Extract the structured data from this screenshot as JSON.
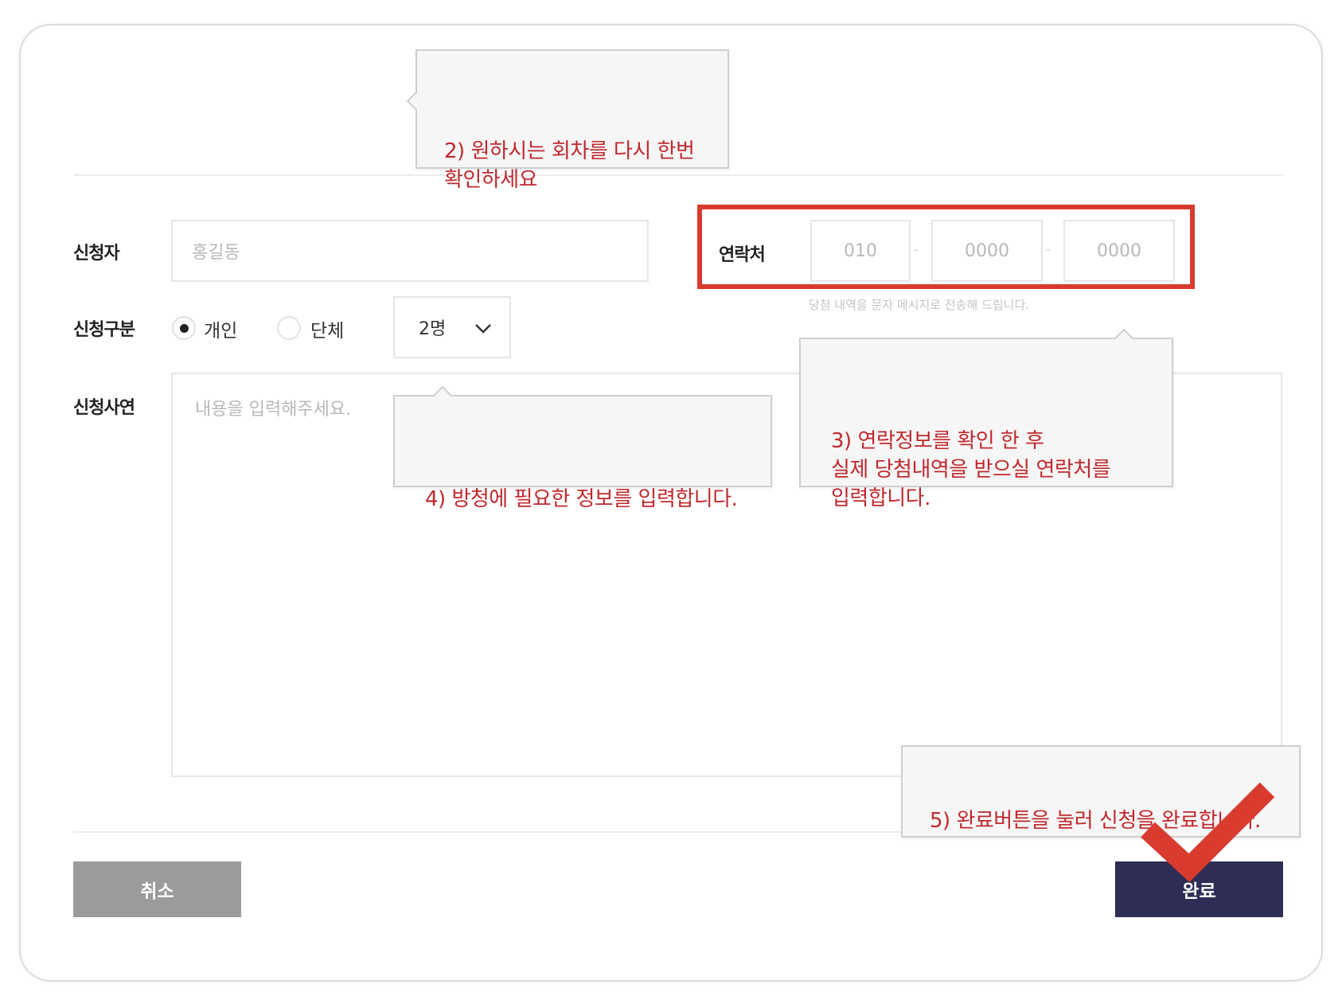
{
  "form": {
    "applicant_label": "신청자",
    "applicant_placeholder": "홍길동",
    "type_label": "신청구분",
    "type_options": [
      "개인",
      "단체"
    ],
    "type_selected": "개인",
    "count_value": "2명",
    "reason_label": "신청사연",
    "reason_placeholder": "내용을 입력해주세요.",
    "contact_label": "연락처",
    "phone_parts": [
      "010",
      "0000",
      "0000"
    ],
    "contact_hint": "당첨 내역을 문자 메시지로 전송해 드립니다."
  },
  "buttons": {
    "cancel_label": "취소",
    "done_label": "완료"
  },
  "callouts": {
    "step2": "2) 원하시는 회차를 다시 한번\n   확인하세요",
    "step3": "3) 연락정보를 확인 한 후\n   실제 당첨내역을 받으실 연락처를\n   입력합니다.",
    "step4": "4) 방청에 필요한 정보를 입력합니다.",
    "step5": "5) 완료버튼을 눌러 신청을 완료합니다."
  },
  "colors": {
    "highlight": "#d93b2f",
    "done_button": "#2d2d55",
    "cancel_button": "#9b9b9b",
    "callout_text": "#c0282d",
    "checkmark": "#d93b2f"
  },
  "icons": {
    "dropdown": "chevron-down-icon",
    "confirm": "checkmark-icon"
  }
}
